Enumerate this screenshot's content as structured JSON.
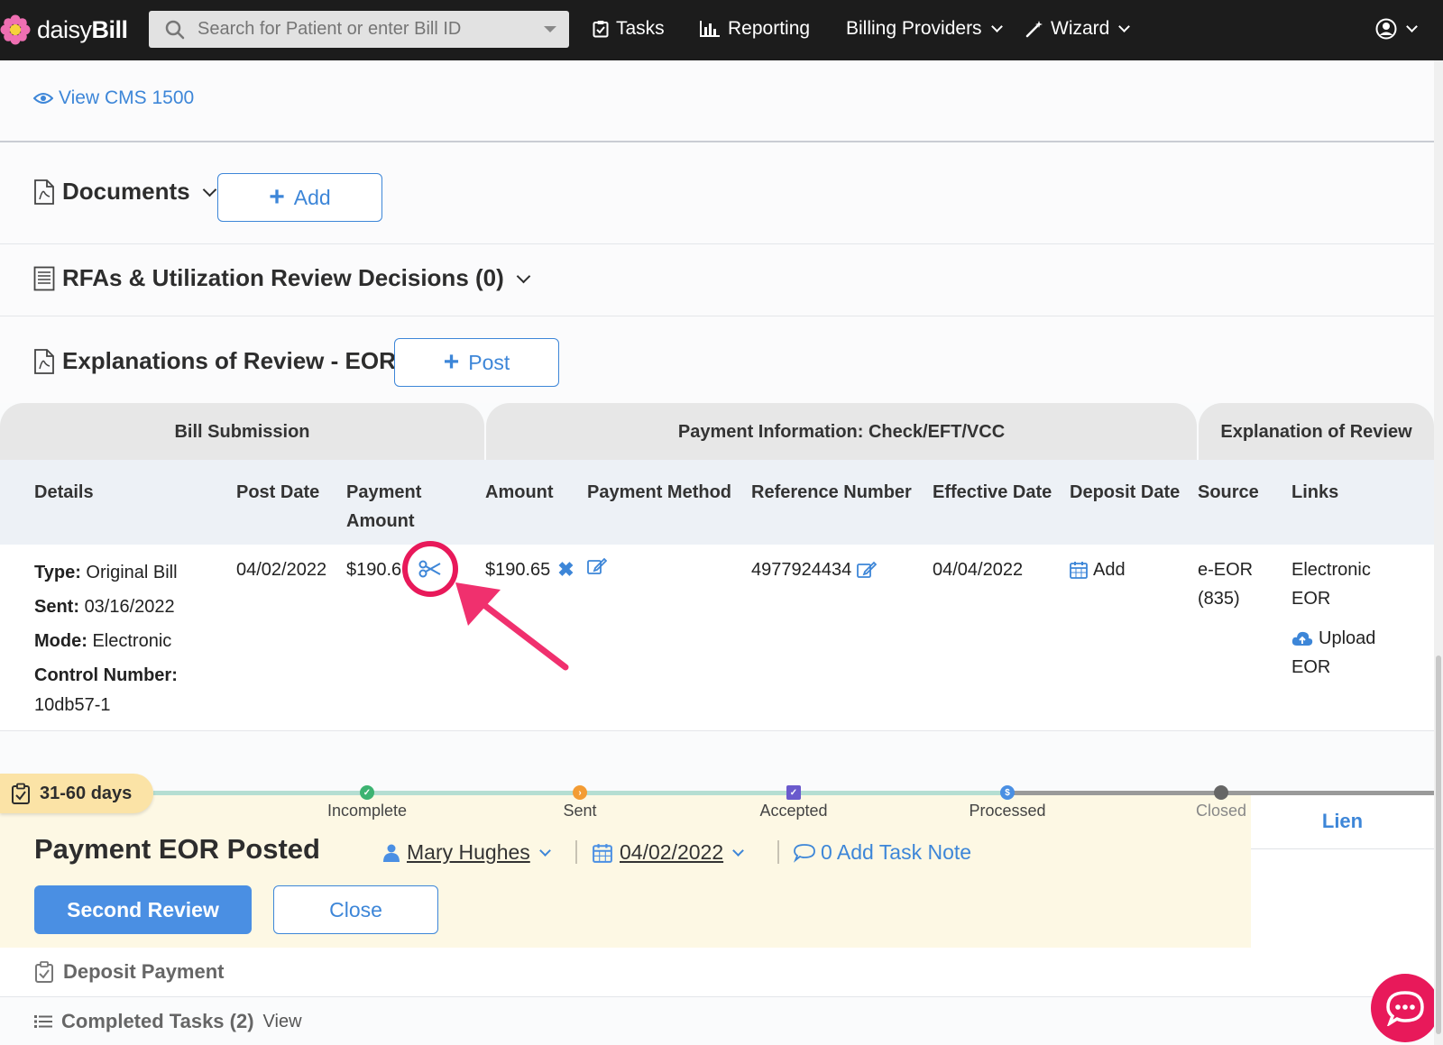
{
  "nav": {
    "logo_prefix": "daisy",
    "logo_suffix": "Bill",
    "search_placeholder": "Search for Patient or enter Bill ID",
    "tasks": "Tasks",
    "reporting": "Reporting",
    "billing_providers": "Billing Providers",
    "wizard": "Wizard"
  },
  "view_cms": "View CMS 1500",
  "documents": {
    "title": "Documents",
    "add_label": "Add"
  },
  "rfas": {
    "title": "RFAs & Utilization Review Decisions (0)"
  },
  "eor": {
    "title": "Explanations of Review - EOR",
    "post_label": "Post",
    "groups": {
      "bill_submission": "Bill Submission",
      "payment_info": "Payment Information: Check/EFT/VCC",
      "explanation": "Explanation of Review"
    },
    "columns": {
      "details": "Details",
      "post_date": "Post Date",
      "payment_amount_l1": "Payment",
      "payment_amount_l2": "Amount",
      "amount": "Amount",
      "payment_method": "Payment Method",
      "reference_number": "Reference Number",
      "effective_date": "Effective Date",
      "deposit_date": "Deposit Date",
      "source": "Source",
      "links": "Links"
    },
    "row": {
      "type_label": "Type:",
      "type_value": "Original Bill",
      "sent_label": "Sent:",
      "sent_value": "03/16/2022",
      "mode_label": "Mode:",
      "mode_value": "Electronic",
      "control_label": "Control Number:",
      "control_value": "10db57-1",
      "post_date": "04/02/2022",
      "payment_amount": "$190.6",
      "amount": "$190.65",
      "reference_number": "4977924434",
      "effective_date": "04/04/2022",
      "deposit_add": "Add",
      "source_l1": "e-EOR",
      "source_l2": "(835)",
      "link_electronic_l1": "Electronic",
      "link_electronic_l2": "EOR",
      "link_upload_l1": "Upload",
      "link_upload_l2": "EOR"
    }
  },
  "task": {
    "days_badge": "31-60 days",
    "stages": [
      "Incomplete",
      "Sent",
      "Accepted",
      "Processed",
      "Closed"
    ],
    "title": "Payment EOR Posted",
    "assignee": "Mary Hughes",
    "due_date": "04/02/2022",
    "task_note": "0 Add Task Note",
    "second_review": "Second Review",
    "close": "Close",
    "lien": "Lien"
  },
  "bottom": {
    "deposit_payment": "Deposit Payment",
    "completed_tasks": "Completed Tasks (2)",
    "view": "View"
  },
  "colors": {
    "accent": "#3d86d8",
    "highlight": "#e8195a",
    "incomplete": "#3cb371",
    "sent": "#f39c34",
    "accepted": "#6a5acd",
    "processed": "#4a8fe3",
    "closed": "#666666"
  }
}
